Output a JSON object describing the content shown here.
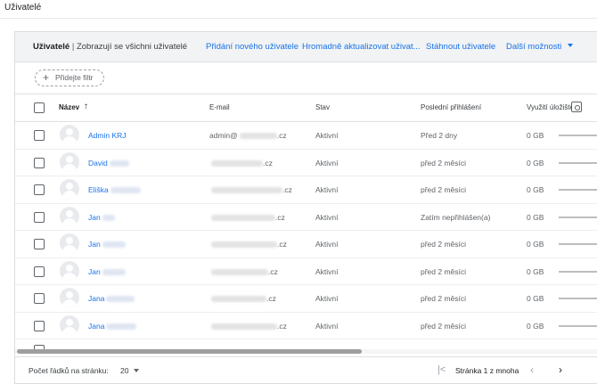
{
  "page": {
    "title": "Uživatelé"
  },
  "toolbar": {
    "title": "Uživatelé",
    "separator": "|",
    "subtitle": "Zobrazují se všichni uživatelé",
    "add_user": "Přidání nového uživatele",
    "bulk_update": "Hromadně aktualizovat uživat...",
    "download": "Stáhnout uživatele",
    "more": "Další možnosti"
  },
  "filter": {
    "add_label": "Přidejte filtr",
    "add_icon": "plus-icon"
  },
  "columns": {
    "name": "Název",
    "email": "E-mail",
    "status": "Stav",
    "last_login": "Poslední přihlášení",
    "storage": "Využití úložiště"
  },
  "users": [
    {
      "first_name": "Admin KRJ",
      "email_prefix": "admin@",
      "email_suffix": ".cz",
      "status": "Aktivní",
      "last_login": "Před 2 dny",
      "storage": "0 GB"
    },
    {
      "first_name": "David",
      "email_prefix": "",
      "email_suffix": ".cz",
      "status": "Aktivní",
      "last_login": "před 2 měsíci",
      "storage": "0 GB"
    },
    {
      "first_name": "Eliška",
      "email_prefix": "",
      "email_suffix": ".cz",
      "status": "Aktivní",
      "last_login": "před 2 měsíci",
      "storage": "0 GB"
    },
    {
      "first_name": "Jan",
      "email_prefix": "",
      "email_suffix": ".cz",
      "status": "Aktivní",
      "last_login": "Zatím nepřihlášen(a)",
      "storage": "0 GB"
    },
    {
      "first_name": "Jan",
      "email_prefix": "",
      "email_suffix": ".cz",
      "status": "Aktivní",
      "last_login": "před 2 měsíci",
      "storage": "0 GB"
    },
    {
      "first_name": "Jan",
      "email_prefix": "",
      "email_suffix": ".cz",
      "status": "Aktivní",
      "last_login": "před 2 měsíci",
      "storage": "0 GB"
    },
    {
      "first_name": "Jana",
      "email_prefix": "",
      "email_suffix": ".cz",
      "status": "Aktivní",
      "last_login": "před 2 měsíci",
      "storage": "0 GB"
    },
    {
      "first_name": "Jana",
      "email_prefix": "",
      "email_suffix": ".cz",
      "status": "Aktivní",
      "last_login": "před 2 měsíci",
      "storage": "0 GB"
    }
  ],
  "footer": {
    "rows_per_page_label": "Počet řádků na stránku:",
    "rows_per_page_value": "20",
    "page_info": "Stránka 1 z mnoha",
    "first_icon": "first-page-icon",
    "prev_icon": "chevron-left-icon",
    "next_icon": "chevron-right-icon"
  },
  "colors": {
    "accent": "#1a73e8",
    "toolbar_bg": "#f1f3f4",
    "muted_text": "#5f6368"
  }
}
